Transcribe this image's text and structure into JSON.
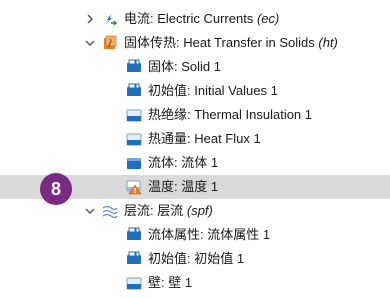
{
  "badge": {
    "number": "8"
  },
  "tree": [
    {
      "name": "tree-node-electric-currents",
      "level": 1,
      "toggle": "collapsed",
      "icon": "electric-currents-icon",
      "prefix": "电流: ",
      "text": "Electric Currents",
      "tag": "(ec)"
    },
    {
      "name": "tree-node-heat-transfer-in-solids",
      "level": 1,
      "toggle": "expanded",
      "icon": "heat-transfer-icon",
      "prefix": "固体传热: ",
      "text": "Heat Transfer in Solids",
      "tag": "(ht)"
    },
    {
      "name": "tree-node-solid-1",
      "level": 2,
      "icon": "domain-feature-icon",
      "prefix": "固体: ",
      "text": "Solid 1",
      "tag": ""
    },
    {
      "name": "tree-node-initial-values-1",
      "level": 2,
      "icon": "domain-feature-icon",
      "prefix": "初始值: ",
      "text": "Initial Values 1",
      "tag": ""
    },
    {
      "name": "tree-node-thermal-insulation-1",
      "level": 2,
      "icon": "boundary-feature-icon",
      "prefix": "热绝缘: ",
      "text": "Thermal Insulation 1",
      "tag": ""
    },
    {
      "name": "tree-node-heat-flux-1",
      "level": 2,
      "icon": "boundary-feature-icon",
      "prefix": "热通量: ",
      "text": "Heat Flux 1",
      "tag": ""
    },
    {
      "name": "tree-node-flow-1",
      "level": 2,
      "icon": "flow-feature-icon",
      "prefix": "流体: ",
      "text": "流体 1",
      "tag": ""
    },
    {
      "name": "tree-node-temperature-1",
      "level": 2,
      "icon": "warning-feature-icon",
      "prefix": "温度: ",
      "text": "温度 1",
      "tag": "",
      "selected": true
    },
    {
      "name": "tree-node-laminar-flow",
      "level": 1,
      "toggle": "expanded",
      "icon": "laminar-flow-icon",
      "prefix": "层流: ",
      "text": "层流",
      "tag": "(spf)"
    },
    {
      "name": "tree-node-fluid-properties-1",
      "level": 2,
      "icon": "domain-feature-icon",
      "prefix": "流体属性: ",
      "text": "流体属性 1",
      "tag": ""
    },
    {
      "name": "tree-node-initial-values-1-cn",
      "level": 2,
      "icon": "domain-feature-icon",
      "prefix": "初始值: ",
      "text": "初始值 1",
      "tag": ""
    },
    {
      "name": "tree-node-wall-1",
      "level": 2,
      "icon": "boundary-feature-icon",
      "prefix": "壁: ",
      "text": "壁 1",
      "tag": ""
    }
  ],
  "colors": {
    "selected_row": "#d9d9d9",
    "badge": "#7a2a84",
    "feature_blue": "#1f6fc0",
    "warning_orange": "#e8821e"
  }
}
